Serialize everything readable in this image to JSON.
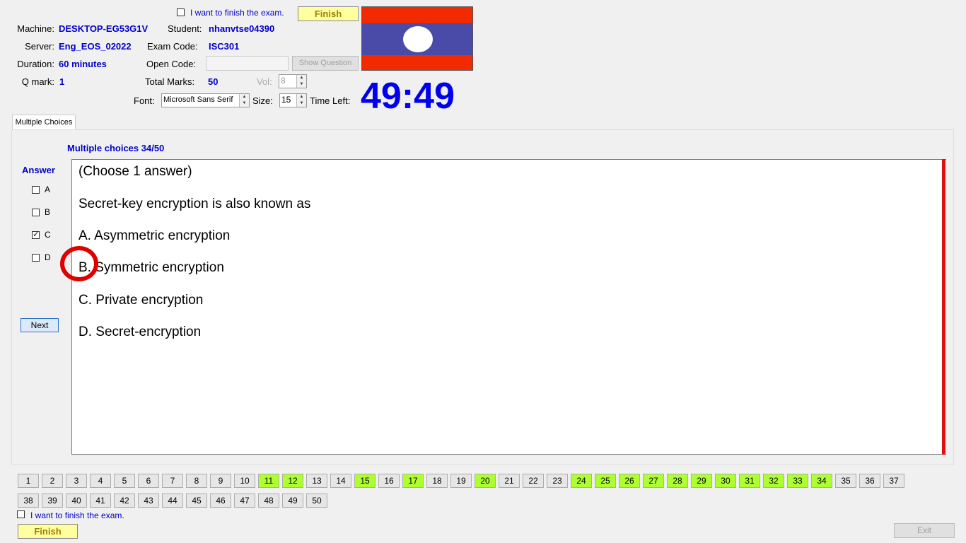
{
  "top": {
    "finish_checkbox_label": "I want to finish the exam.",
    "finish_button": "Finish",
    "machine_label": "Machine:",
    "machine_value": "DESKTOP-EG53G1V",
    "student_label": "Student:",
    "student_value": "nhanvtse04390",
    "server_label": "Server:",
    "server_value": "Eng_EOS_02022",
    "exam_code_label": "Exam Code:",
    "exam_code_value": "ISC301",
    "duration_label": "Duration:",
    "duration_value": "60 minutes",
    "open_code_label": "Open Code:",
    "open_code_value": "",
    "show_question_button": "Show Question",
    "q_mark_label": "Q mark:",
    "q_mark_value": "1",
    "total_marks_label": "Total Marks:",
    "total_marks_value": "50",
    "vol_label": "Vol:",
    "vol_value": "8",
    "font_label": "Font:",
    "font_value": "Microsoft Sans Serif",
    "size_label": "Size:",
    "size_value": "15",
    "time_left_label": "Time Left:",
    "time_left_value": "49:49"
  },
  "flag": {
    "top_color": "#f12a00",
    "mid_color": "#4a4aa8",
    "circle_color": "#ffffff"
  },
  "tab": {
    "label": "Multiple Choices"
  },
  "question": {
    "header": "Multiple choices 34/50",
    "answer_title": "Answer",
    "answers": [
      {
        "label": "A",
        "checked": false
      },
      {
        "label": "B",
        "checked": false
      },
      {
        "label": "C",
        "checked": true
      },
      {
        "label": "D",
        "checked": false
      }
    ],
    "next_button": "Next",
    "lines": [
      "(Choose 1 answer)",
      "Secret-key encryption is also known as",
      "A.  Asymmetric encryption",
      "B.  Symmetric encryption",
      "C.  Private encryption",
      "D.  Secret-encryption"
    ]
  },
  "question_nav": {
    "numbers": [
      "1",
      "2",
      "3",
      "4",
      "5",
      "6",
      "7",
      "8",
      "9",
      "10",
      "11",
      "12",
      "13",
      "14",
      "15",
      "16",
      "17",
      "18",
      "19",
      "20",
      "21",
      "22",
      "23",
      "24",
      "25",
      "26",
      "27",
      "28",
      "29",
      "30",
      "31",
      "32",
      "33",
      "34",
      "35",
      "36",
      "37",
      "38",
      "39",
      "40",
      "41",
      "42",
      "43",
      "44",
      "45",
      "46",
      "47",
      "48",
      "49",
      "50"
    ],
    "answered": [
      "11",
      "12",
      "15",
      "17",
      "20",
      "24",
      "25",
      "26",
      "27",
      "28",
      "29",
      "30",
      "31",
      "32",
      "33",
      "34"
    ]
  },
  "bottom": {
    "finish_checkbox_label": "I want to finish the exam.",
    "finish_button": "Finish",
    "exit_button": "Exit"
  },
  "colors": {
    "accent_blue": "#0000cc",
    "answered_green": "#adff2f",
    "scroll_red": "#e01010",
    "annotation_red": "#e00000"
  }
}
